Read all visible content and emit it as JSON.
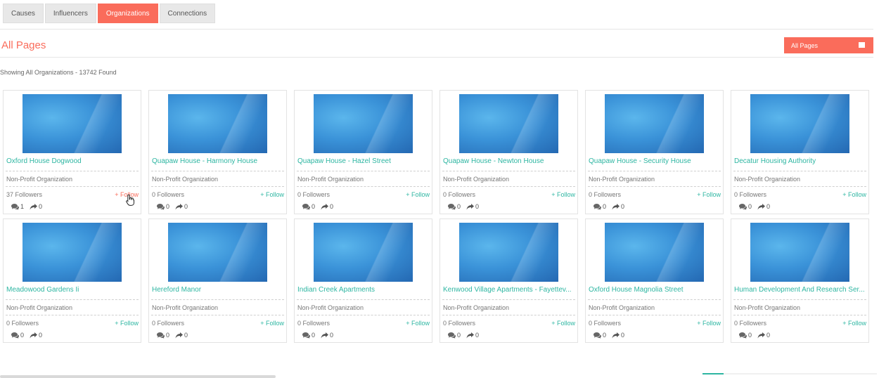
{
  "tabs": [
    {
      "label": "Causes",
      "active": false
    },
    {
      "label": "Influencers",
      "active": false
    },
    {
      "label": "Organizations",
      "active": true
    },
    {
      "label": "Connections",
      "active": false
    }
  ],
  "page_title": "All Pages",
  "filter_button": {
    "label": "All Pages",
    "icon": "list-icon"
  },
  "showing_text": "Showing All Organizations - 13742 Found",
  "follow_label": "+ Follow",
  "cards": [
    {
      "name": "Oxford House Dogwood",
      "type": "Non-Profit Organization",
      "followers": "37 Followers",
      "comments": "1",
      "shares": "0"
    },
    {
      "name": "Quapaw House - Harmony House",
      "type": "Non-Profit Organization",
      "followers": "0 Followers",
      "comments": "0",
      "shares": "0"
    },
    {
      "name": "Quapaw House - Hazel Street",
      "type": "Non-Profit Organization",
      "followers": "0 Followers",
      "comments": "0",
      "shares": "0"
    },
    {
      "name": "Quapaw House - Newton House",
      "type": "Non-Profit Organization",
      "followers": "0 Followers",
      "comments": "0",
      "shares": "0"
    },
    {
      "name": "Quapaw House - Security House",
      "type": "Non-Profit Organization",
      "followers": "0 Followers",
      "comments": "0",
      "shares": "0"
    },
    {
      "name": "Decatur Housing Authority",
      "type": "Non-Profit Organization",
      "followers": "0 Followers",
      "comments": "0",
      "shares": "0"
    },
    {
      "name": "Meadowood Gardens Ii",
      "type": "Non-Profit Organization",
      "followers": "0 Followers",
      "comments": "0",
      "shares": "0"
    },
    {
      "name": "Hereford Manor",
      "type": "Non-Profit Organization",
      "followers": "0 Followers",
      "comments": "0",
      "shares": "0"
    },
    {
      "name": "Indian Creek Apartments",
      "type": "Non-Profit Organization",
      "followers": "0 Followers",
      "comments": "0",
      "shares": "0"
    },
    {
      "name": "Kenwood Village Apartments - Fayettev...",
      "type": "Non-Profit Organization",
      "followers": "0 Followers",
      "comments": "0",
      "shares": "0"
    },
    {
      "name": "Oxford House Magnolia Street",
      "type": "Non-Profit Organization",
      "followers": "0 Followers",
      "comments": "0",
      "shares": "0"
    },
    {
      "name": "Human Development And Research Ser...",
      "type": "Non-Profit Organization",
      "followers": "0 Followers",
      "comments": "0",
      "shares": "0"
    }
  ],
  "colors": {
    "accent": "#fa6c5b",
    "link": "#2eb6a2"
  }
}
